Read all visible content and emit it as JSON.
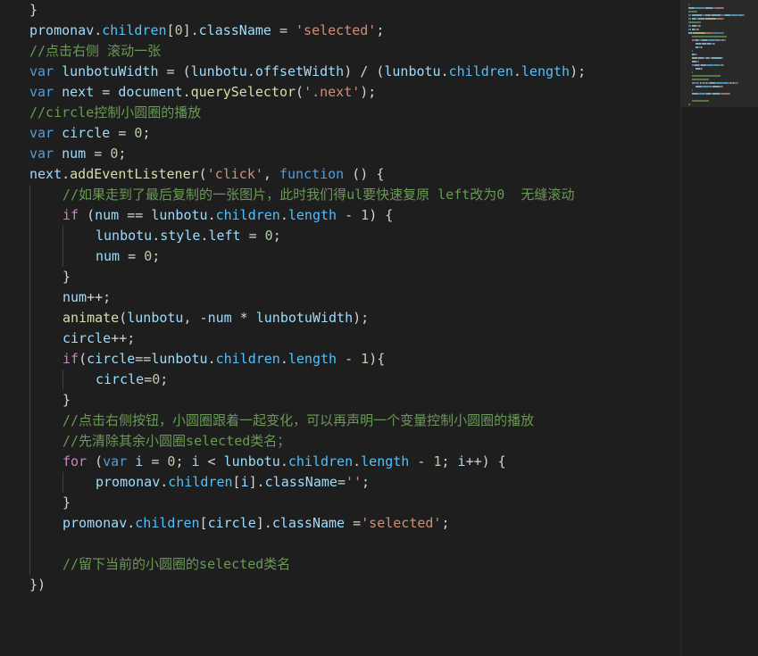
{
  "editor": {
    "theme": {
      "background": "#1e1e1e",
      "keyword": "#569cd6",
      "control": "#c586c0",
      "variable": "#9cdcfe",
      "function": "#dcdcaa",
      "string": "#ce9178",
      "number": "#b5cea8",
      "comment": "#6a9955",
      "text": "#d4d4d4"
    },
    "lines": [
      {
        "indent": 0,
        "tokens": [
          {
            "t": "pun",
            "v": "}"
          }
        ]
      },
      {
        "indent": 0,
        "tokens": [
          {
            "t": "var",
            "v": "promonav"
          },
          {
            "t": "pun",
            "v": "."
          },
          {
            "t": "prop2",
            "v": "children"
          },
          {
            "t": "pun",
            "v": "["
          },
          {
            "t": "num",
            "v": "0"
          },
          {
            "t": "pun",
            "v": "]."
          },
          {
            "t": "var",
            "v": "className"
          },
          {
            "t": "pun",
            "v": " = "
          },
          {
            "t": "str",
            "v": "'selected'"
          },
          {
            "t": "pun",
            "v": ";"
          }
        ]
      },
      {
        "indent": 0,
        "tokens": [
          {
            "t": "com",
            "v": "//点击右侧 滚动一张"
          }
        ]
      },
      {
        "indent": 0,
        "tokens": [
          {
            "t": "kw",
            "v": "var"
          },
          {
            "t": "pun",
            "v": " "
          },
          {
            "t": "var",
            "v": "lunbotuWidth"
          },
          {
            "t": "pun",
            "v": " = ("
          },
          {
            "t": "var",
            "v": "lunbotu"
          },
          {
            "t": "pun",
            "v": "."
          },
          {
            "t": "var",
            "v": "offsetWidth"
          },
          {
            "t": "pun",
            "v": ") / ("
          },
          {
            "t": "var",
            "v": "lunbotu"
          },
          {
            "t": "pun",
            "v": "."
          },
          {
            "t": "prop2",
            "v": "children"
          },
          {
            "t": "pun",
            "v": "."
          },
          {
            "t": "prop2",
            "v": "length"
          },
          {
            "t": "pun",
            "v": ");"
          }
        ]
      },
      {
        "indent": 0,
        "tokens": [
          {
            "t": "kw",
            "v": "var"
          },
          {
            "t": "pun",
            "v": " "
          },
          {
            "t": "var",
            "v": "next"
          },
          {
            "t": "pun",
            "v": " = "
          },
          {
            "t": "var",
            "v": "document"
          },
          {
            "t": "pun",
            "v": "."
          },
          {
            "t": "fn",
            "v": "querySelector"
          },
          {
            "t": "pun",
            "v": "("
          },
          {
            "t": "str",
            "v": "'.next'"
          },
          {
            "t": "pun",
            "v": ");"
          }
        ]
      },
      {
        "indent": 0,
        "tokens": [
          {
            "t": "com",
            "v": "//circle控制小圆圈的播放"
          }
        ]
      },
      {
        "indent": 0,
        "tokens": [
          {
            "t": "kw",
            "v": "var"
          },
          {
            "t": "pun",
            "v": " "
          },
          {
            "t": "var",
            "v": "circle"
          },
          {
            "t": "pun",
            "v": " = "
          },
          {
            "t": "num",
            "v": "0"
          },
          {
            "t": "pun",
            "v": ";"
          }
        ]
      },
      {
        "indent": 0,
        "tokens": [
          {
            "t": "kw",
            "v": "var"
          },
          {
            "t": "pun",
            "v": " "
          },
          {
            "t": "var",
            "v": "num"
          },
          {
            "t": "pun",
            "v": " = "
          },
          {
            "t": "num",
            "v": "0"
          },
          {
            "t": "pun",
            "v": ";"
          }
        ]
      },
      {
        "indent": 0,
        "tokens": [
          {
            "t": "var",
            "v": "next"
          },
          {
            "t": "pun",
            "v": "."
          },
          {
            "t": "fn",
            "v": "addEventListener"
          },
          {
            "t": "pun",
            "v": "("
          },
          {
            "t": "str",
            "v": "'click'"
          },
          {
            "t": "pun",
            "v": ", "
          },
          {
            "t": "kw",
            "v": "function"
          },
          {
            "t": "pun",
            "v": " () {"
          }
        ]
      },
      {
        "indent": 1,
        "tokens": [
          {
            "t": "com",
            "v": "//如果走到了最后复制的一张图片，此时我们得ul要快速复原 left改为0  无缝滚动"
          }
        ]
      },
      {
        "indent": 1,
        "tokens": [
          {
            "t": "ctl",
            "v": "if"
          },
          {
            "t": "pun",
            "v": " ("
          },
          {
            "t": "var",
            "v": "num"
          },
          {
            "t": "pun",
            "v": " == "
          },
          {
            "t": "var",
            "v": "lunbotu"
          },
          {
            "t": "pun",
            "v": "."
          },
          {
            "t": "prop2",
            "v": "children"
          },
          {
            "t": "pun",
            "v": "."
          },
          {
            "t": "prop2",
            "v": "length"
          },
          {
            "t": "pun",
            "v": " - "
          },
          {
            "t": "num",
            "v": "1"
          },
          {
            "t": "pun",
            "v": ") {"
          }
        ]
      },
      {
        "indent": 2,
        "tokens": [
          {
            "t": "var",
            "v": "lunbotu"
          },
          {
            "t": "pun",
            "v": "."
          },
          {
            "t": "var",
            "v": "style"
          },
          {
            "t": "pun",
            "v": "."
          },
          {
            "t": "var",
            "v": "left"
          },
          {
            "t": "pun",
            "v": " = "
          },
          {
            "t": "num",
            "v": "0"
          },
          {
            "t": "pun",
            "v": ";"
          }
        ]
      },
      {
        "indent": 2,
        "tokens": [
          {
            "t": "var",
            "v": "num"
          },
          {
            "t": "pun",
            "v": " = "
          },
          {
            "t": "num",
            "v": "0"
          },
          {
            "t": "pun",
            "v": ";"
          }
        ]
      },
      {
        "indent": 1,
        "tokens": [
          {
            "t": "pun",
            "v": "}"
          }
        ]
      },
      {
        "indent": 1,
        "tokens": [
          {
            "t": "var",
            "v": "num"
          },
          {
            "t": "pun",
            "v": "++;"
          }
        ]
      },
      {
        "indent": 1,
        "tokens": [
          {
            "t": "fn",
            "v": "animate"
          },
          {
            "t": "pun",
            "v": "("
          },
          {
            "t": "var",
            "v": "lunbotu"
          },
          {
            "t": "pun",
            "v": ", -"
          },
          {
            "t": "var",
            "v": "num"
          },
          {
            "t": "pun",
            "v": " * "
          },
          {
            "t": "var",
            "v": "lunbotuWidth"
          },
          {
            "t": "pun",
            "v": ");"
          }
        ]
      },
      {
        "indent": 1,
        "tokens": [
          {
            "t": "var",
            "v": "circle"
          },
          {
            "t": "pun",
            "v": "++;"
          }
        ]
      },
      {
        "indent": 1,
        "tokens": [
          {
            "t": "ctl",
            "v": "if"
          },
          {
            "t": "pun",
            "v": "("
          },
          {
            "t": "var",
            "v": "circle"
          },
          {
            "t": "pun",
            "v": "=="
          },
          {
            "t": "var",
            "v": "lunbotu"
          },
          {
            "t": "pun",
            "v": "."
          },
          {
            "t": "prop2",
            "v": "children"
          },
          {
            "t": "pun",
            "v": "."
          },
          {
            "t": "prop2",
            "v": "length"
          },
          {
            "t": "pun",
            "v": " - "
          },
          {
            "t": "num",
            "v": "1"
          },
          {
            "t": "pun",
            "v": "){"
          }
        ]
      },
      {
        "indent": 2,
        "tokens": [
          {
            "t": "var",
            "v": "circle"
          },
          {
            "t": "pun",
            "v": "="
          },
          {
            "t": "num",
            "v": "0"
          },
          {
            "t": "pun",
            "v": ";"
          }
        ]
      },
      {
        "indent": 1,
        "tokens": [
          {
            "t": "pun",
            "v": "}"
          }
        ]
      },
      {
        "indent": 1,
        "tokens": [
          {
            "t": "com",
            "v": "//点击右侧按钮，小圆圈跟着一起变化，可以再声明一个变量控制小圆圈的播放"
          }
        ]
      },
      {
        "indent": 1,
        "tokens": [
          {
            "t": "com",
            "v": "//先清除其余小圆圈selected类名；"
          }
        ]
      },
      {
        "indent": 1,
        "tokens": [
          {
            "t": "ctl",
            "v": "for"
          },
          {
            "t": "pun",
            "v": " ("
          },
          {
            "t": "kw",
            "v": "var"
          },
          {
            "t": "pun",
            "v": " "
          },
          {
            "t": "var",
            "v": "i"
          },
          {
            "t": "pun",
            "v": " = "
          },
          {
            "t": "num",
            "v": "0"
          },
          {
            "t": "pun",
            "v": "; "
          },
          {
            "t": "var",
            "v": "i"
          },
          {
            "t": "pun",
            "v": " < "
          },
          {
            "t": "var",
            "v": "lunbotu"
          },
          {
            "t": "pun",
            "v": "."
          },
          {
            "t": "prop2",
            "v": "children"
          },
          {
            "t": "pun",
            "v": "."
          },
          {
            "t": "prop2",
            "v": "length"
          },
          {
            "t": "pun",
            "v": " - "
          },
          {
            "t": "num",
            "v": "1"
          },
          {
            "t": "pun",
            "v": "; "
          },
          {
            "t": "var",
            "v": "i"
          },
          {
            "t": "pun",
            "v": "++) {"
          }
        ]
      },
      {
        "indent": 2,
        "tokens": [
          {
            "t": "var",
            "v": "promonav"
          },
          {
            "t": "pun",
            "v": "."
          },
          {
            "t": "prop2",
            "v": "children"
          },
          {
            "t": "pun",
            "v": "["
          },
          {
            "t": "var",
            "v": "i"
          },
          {
            "t": "pun",
            "v": "]."
          },
          {
            "t": "var",
            "v": "className"
          },
          {
            "t": "pun",
            "v": "="
          },
          {
            "t": "str",
            "v": "''"
          },
          {
            "t": "pun",
            "v": ";"
          }
        ]
      },
      {
        "indent": 1,
        "tokens": [
          {
            "t": "pun",
            "v": "}"
          }
        ]
      },
      {
        "indent": 1,
        "tokens": [
          {
            "t": "var",
            "v": "promonav"
          },
          {
            "t": "pun",
            "v": "."
          },
          {
            "t": "prop2",
            "v": "children"
          },
          {
            "t": "pun",
            "v": "["
          },
          {
            "t": "var",
            "v": "circle"
          },
          {
            "t": "pun",
            "v": "]."
          },
          {
            "t": "var",
            "v": "className"
          },
          {
            "t": "pun",
            "v": " ="
          },
          {
            "t": "str",
            "v": "'selected'"
          },
          {
            "t": "pun",
            "v": ";"
          }
        ]
      },
      {
        "indent": 1,
        "tokens": []
      },
      {
        "indent": 1,
        "tokens": [
          {
            "t": "com",
            "v": "//留下当前的小圆圈的selected类名"
          }
        ]
      },
      {
        "indent": 0,
        "tokens": [
          {
            "t": "pun",
            "v": "})"
          }
        ]
      }
    ]
  }
}
